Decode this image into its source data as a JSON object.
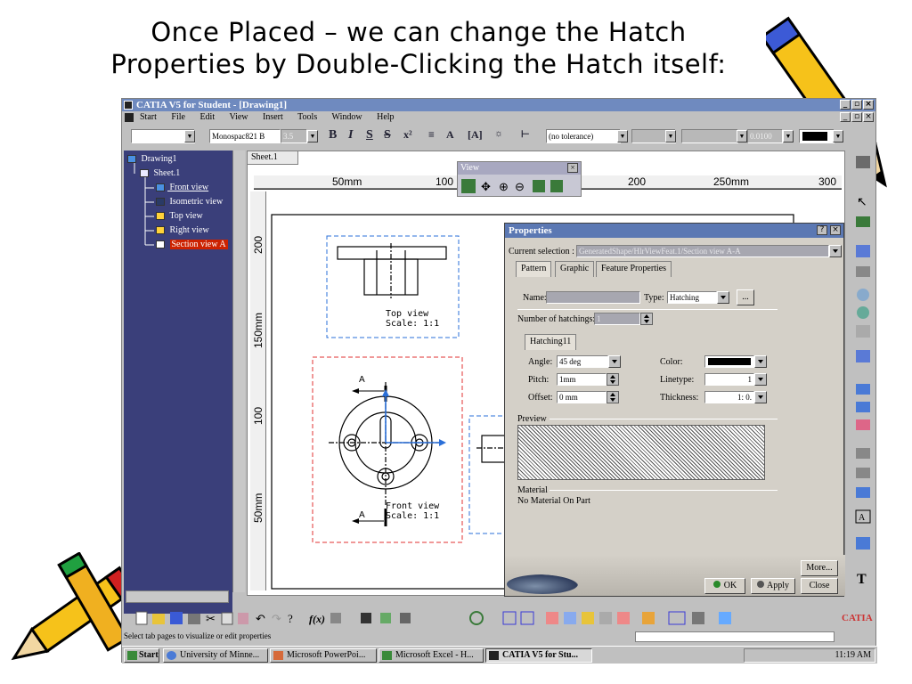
{
  "slide": {
    "title_line1": "Once Placed – we can change the Hatch",
    "title_line2": "Properties by Double-Clicking the Hatch itself:"
  },
  "window": {
    "title": "CATIA V5 for Student - [Drawing1]",
    "menu": [
      "Start",
      "File",
      "Edit",
      "View",
      "Insert",
      "Tools",
      "Window",
      "Help"
    ]
  },
  "toolbar": {
    "font_name": "Monospac821 B",
    "font_size": "3.5",
    "tolerance": "(no tolerance)",
    "thickness": "0.0100"
  },
  "tree": {
    "root": "Drawing1",
    "sheet": "Sheet.1",
    "items": [
      "Front view",
      "Isometric view",
      "Top view",
      "Right view",
      "Section view A"
    ]
  },
  "sheet": {
    "tab": "Sheet.1",
    "ruler_h": [
      "50mm",
      "100",
      "200",
      "250mm",
      "300"
    ],
    "ruler_v": [
      "200",
      "150mm",
      "100",
      "50mm"
    ]
  },
  "drawing": {
    "top_view_label": "Top view",
    "top_view_scale": "Scale:  1:1",
    "front_view_label": "Front view",
    "front_view_scale": "Scale:  1:1",
    "section_mark": "A"
  },
  "view_toolbar": {
    "title": "View"
  },
  "properties": {
    "title": "Properties",
    "current_selection_label": "Current selection :",
    "current_selection_value": "GeneratedShape/HlrViewFeat.1/Section view A-A",
    "tabs": [
      "Pattern",
      "Graphic",
      "Feature Properties"
    ],
    "name_label": "Name:",
    "name_value": "",
    "type_label": "Type:",
    "type_value": "Hatching",
    "browse_label": "...",
    "num_hatchings_label": "Number of hatchings:",
    "num_hatchings_value": "1",
    "hatching_tab": "Hatching11",
    "angle_label": "Angle:",
    "angle_value": "45 deg",
    "pitch_label": "Pitch:",
    "pitch_value": "1mm",
    "offset_label": "Offset:",
    "offset_value": "0 mm",
    "color_label": "Color:",
    "linetype_label": "Linetype:",
    "linetype_value": "1",
    "thickness_label": "Thickness:",
    "thickness_value": "1: 0.",
    "preview_label": "Preview",
    "material_label": "Material",
    "material_value": "No Material On Part",
    "more_button": "More...",
    "ok_button": "OK",
    "apply_button": "Apply",
    "close_button": "Close"
  },
  "status_bar": {
    "text": "Select tab pages to visualize or edit properties"
  },
  "taskbar": {
    "start": "Start",
    "tasks": [
      "University of Minne...",
      "Microsoft PowerPoi...",
      "Microsoft Excel - H...",
      "CATIA V5 for Stu..."
    ],
    "time": "11:19 AM"
  },
  "colors": {
    "tree_bg": "#3a3f7a",
    "title_blue": "#6f8abf",
    "selection_red": "#cc2200",
    "dim_blue": "#2a6fd8"
  }
}
